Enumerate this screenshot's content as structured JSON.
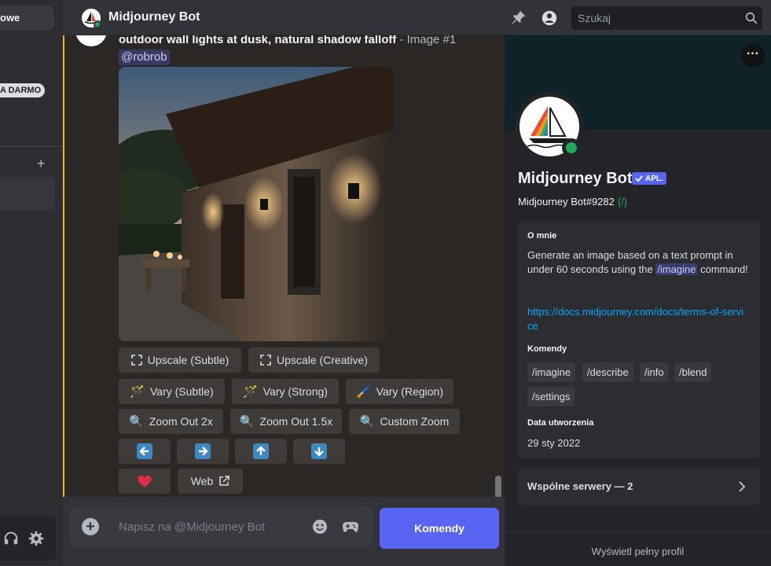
{
  "sidebar": {
    "pill_text": "owe",
    "badge_text": "A DARMO",
    "plus": "+"
  },
  "header": {
    "title": "Midjourney Bot",
    "search_placeholder": "Szukaj"
  },
  "message": {
    "prompt": "outdoor wall lights at dusk, natural shadow falloff",
    "suffix": " - Image #1",
    "mention": "@robrob",
    "buttons": {
      "upscale_subtle": "Upscale (Subtle)",
      "upscale_creative": "Upscale (Creative)",
      "vary_subtle": "Vary (Subtle)",
      "vary_strong": "Vary (Strong)",
      "vary_region": "Vary (Region)",
      "zoom_2x": "Zoom Out 2x",
      "zoom_15x": "Zoom Out 1.5x",
      "custom_zoom": "Custom Zoom",
      "web": "Web"
    }
  },
  "composer": {
    "placeholder": "Napisz na @Midjourney Bot",
    "commands_button": "Komendy"
  },
  "profile": {
    "name": "Midjourney Bot",
    "app_tag": "APL.",
    "handle": "Midjourney Bot#9282",
    "handle_slash": "{/}",
    "about_heading": "O mnie",
    "about_text_1": "Generate an image based on a text prompt in under 60 seconds using the ",
    "about_command": "/imagine",
    "about_text_2": " command!",
    "link": "https://docs.midjourney.com/docs/terms-of-service",
    "commands_heading": "Komendy",
    "commands": [
      "/imagine",
      "/describe",
      "/info",
      "/blend",
      "/settings"
    ],
    "created_heading": "Data utworzenia",
    "created_date": "29 sty 2022",
    "mutual_servers": "Wspólne serwery — 2",
    "view_full_profile": "Wyświetl pełny profil"
  },
  "colors": {
    "accent": "#5865f2",
    "online": "#23a55a",
    "highlight": "#f0b232",
    "link": "#00a8fc"
  }
}
